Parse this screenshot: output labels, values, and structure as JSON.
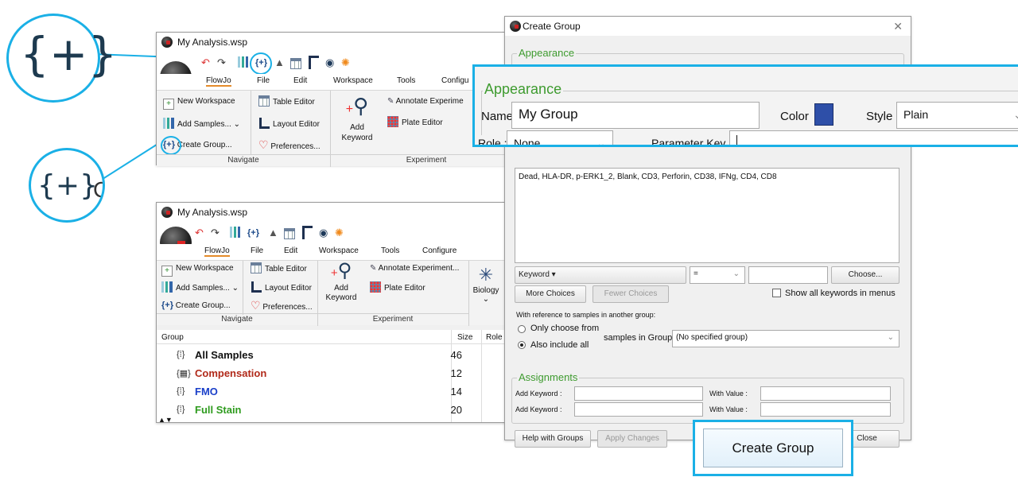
{
  "colors": {
    "accent": "#1ab0e6",
    "legend_green": "#3e9b2f",
    "group_color": "#2e4fa8",
    "compensation": "#b12a1a",
    "fmo": "#1a3fc9",
    "full_stain": "#2e9b1e"
  },
  "callouts": {
    "icon_big": "{+}",
    "icon_small": "{+}",
    "icon_small_text": "C"
  },
  "window_top": {
    "title": "My Analysis.wsp",
    "tabs": [
      "FlowJo",
      "File",
      "Edit",
      "Workspace",
      "Tools",
      "Configu"
    ],
    "ribbon": {
      "new_workspace": "New Workspace",
      "add_samples": "Add Samples...",
      "create_group": "Create Group...",
      "table_editor": "Table Editor",
      "layout_editor": "Layout Editor",
      "preferences": "Preferences...",
      "add_keyword_1": "Add",
      "add_keyword_2": "Keyword",
      "annotate": "Annotate Experime",
      "plate_editor": "Plate Editor",
      "navigate": "Navigate",
      "experiment": "Experiment"
    }
  },
  "window_bottom": {
    "title": "My Analysis.wsp",
    "tabs": [
      "FlowJo",
      "File",
      "Edit",
      "Workspace",
      "Tools",
      "Configure"
    ],
    "ribbon": {
      "new_workspace": "New Workspace",
      "add_samples": "Add Samples...",
      "create_group": "Create Group...",
      "table_editor": "Table Editor",
      "layout_editor": "Layout Editor",
      "preferences": "Preferences...",
      "add_keyword_1": "Add",
      "add_keyword_2": "Keyword",
      "annotate": "Annotate Experiment...",
      "plate_editor": "Plate Editor",
      "biology": "Biology",
      "navigate": "Navigate",
      "experiment": "Experiment"
    },
    "list": {
      "col_group": "Group",
      "col_size": "Size",
      "col_role": "Role",
      "rows": [
        {
          "name": "All Samples",
          "size": "46",
          "icon": "{⁞}"
        },
        {
          "name": "Compensation",
          "size": "12",
          "icon": "{▦}"
        },
        {
          "name": "FMO",
          "size": "14",
          "icon": "{⁞}"
        },
        {
          "name": "Full Stain",
          "size": "20",
          "icon": "{⁞}"
        }
      ]
    }
  },
  "dialog": {
    "title": "Create Group",
    "appearance_legend": "Appearance",
    "keywords_text": "Dead, HLA-DR, p-ERK1_2, Blank, CD3, Perforin, CD38, IFNg, CD4, CD8",
    "keyword_select": "Keyword",
    "operator": "=",
    "choose": "Choose...",
    "more_choices": "More Choices",
    "fewer_choices": "Fewer Choices",
    "show_all_keywords": "Show all keywords in menus",
    "with_reference": "With reference to samples in another group:",
    "only_choose": "Only choose from",
    "also_include": "Also include all",
    "samples_in_group": "samples in Group",
    "group_select": "(No specified group)",
    "assignments_legend": "Assignments",
    "add_keyword_label": "Add Keyword :",
    "with_value_label": "With Value :",
    "help_button": "Help with Groups",
    "apply_button": "Apply Changes",
    "close_button": "Close"
  },
  "zoom_panel": {
    "legend": "Appearance",
    "name_label": "Name",
    "name_value": "My Group",
    "color_label": "Color",
    "style_label": "Style",
    "style_value": "Plain",
    "role_label": "Role :",
    "role_value": "None",
    "param_label": "Parameter Key :"
  },
  "create_button_callout": "Create Group"
}
